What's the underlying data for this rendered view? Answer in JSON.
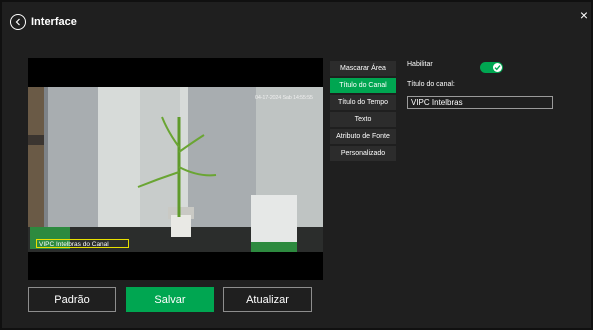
{
  "header": {
    "title": "Interface"
  },
  "video": {
    "channel_title_overlay": "VIPC Intelbras do Canal",
    "time_overlay": "04-17-2024 Sab 14:55:55"
  },
  "menu": {
    "items": [
      {
        "label": "Mascarar Área"
      },
      {
        "label": "Título do Canal"
      },
      {
        "label": "Título do Tempo"
      },
      {
        "label": "Texto"
      },
      {
        "label": "Atributo de Fonte"
      },
      {
        "label": "Personalizado"
      }
    ]
  },
  "settings": {
    "enable_label": "Habilitar",
    "enabled": true,
    "channel_title_label": "Título do canal:",
    "channel_title_value": "VIPC Intelbras"
  },
  "buttons": {
    "default_label": "Padrão",
    "save_label": "Salvar",
    "refresh_label": "Atualizar"
  },
  "colors": {
    "accent": "#00a651",
    "overlay_box": "#e8e000",
    "background": "#1f1f1f"
  }
}
